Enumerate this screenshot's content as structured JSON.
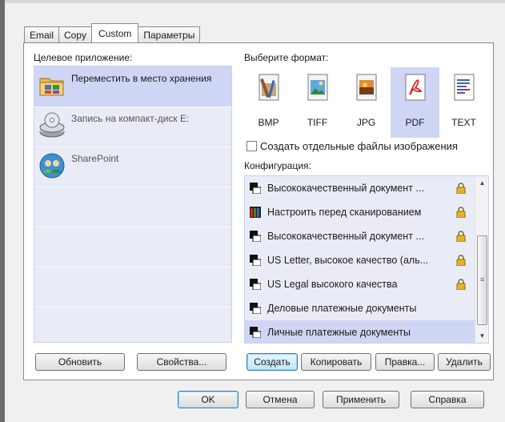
{
  "tabs": [
    "Email",
    "Copy",
    "Custom",
    "Параметры"
  ],
  "active_tab": "Custom",
  "destination": {
    "label": "Целевое приложение:",
    "items": [
      {
        "label": "Переместить в место хранения",
        "icon": "storage-folder-icon",
        "selected": true
      },
      {
        "label": "Запись на компакт-диск  E:",
        "icon": "cd-burn-icon",
        "selected": false
      },
      {
        "label": "SharePoint",
        "icon": "sharepoint-icon",
        "selected": false
      }
    ]
  },
  "format": {
    "label": "Выберите формат:",
    "options": [
      {
        "label": "BMP",
        "icon": "bmp-file-icon"
      },
      {
        "label": "TIFF",
        "icon": "tiff-file-icon"
      },
      {
        "label": "JPG",
        "icon": "jpg-file-icon"
      },
      {
        "label": "PDF",
        "icon": "pdf-file-icon"
      },
      {
        "label": "TEXT",
        "icon": "text-file-icon"
      }
    ],
    "selected": "PDF"
  },
  "separate_files": {
    "label": "Создать отдельные файлы изображения",
    "checked": false
  },
  "configuration": {
    "label": "Конфигурация:",
    "items": [
      {
        "label": "Высококачественный документ ...",
        "locked": true
      },
      {
        "label": "Настроить перед сканированием",
        "locked": true
      },
      {
        "label": "Высококачественный документ ...",
        "locked": true
      },
      {
        "label": "US Letter, высокое качество (аль...",
        "locked": true
      },
      {
        "label": "US Legal высокого качества",
        "locked": true
      },
      {
        "label": "Деловые платежные документы",
        "locked": false
      },
      {
        "label": "Личные платежные документы",
        "locked": false,
        "selected": true
      }
    ]
  },
  "buttons": {
    "refresh": "Обновить",
    "properties": "Свойства...",
    "create": "Создать",
    "copy": "Копировать",
    "edit": "Правка...",
    "delete": "Удалить",
    "ok": "OK",
    "cancel": "Отмена",
    "apply": "Применить",
    "help": "Справка"
  },
  "colors": {
    "selection": "#cfd6f5",
    "list_background": "#e9ecf7",
    "lock": "#d9a520"
  }
}
